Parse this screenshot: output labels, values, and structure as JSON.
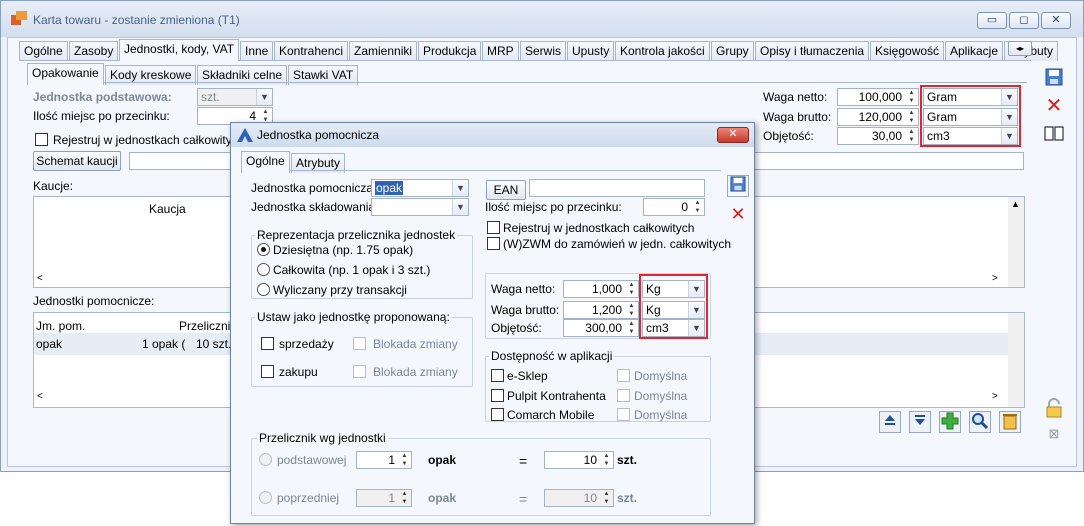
{
  "window": {
    "title": "Karta towaru - zostanie zmieniona (T1)",
    "minimize": "▭",
    "maximize": "◻",
    "close": "✕"
  },
  "main_tabs": [
    "Ogólne",
    "Zasoby",
    "Jednostki, kody, VAT",
    "Inne",
    "Kontrahenci",
    "Zamienniki",
    "Produkcja",
    "MRP",
    "Serwis",
    "Upusty",
    "Kontrola jakości",
    "Grupy",
    "Opisy i tłumaczenia",
    "Księgowość",
    "Aplikacje",
    "Atrybuty"
  ],
  "tab_scroll": [
    "◂",
    "▸"
  ],
  "sub_tabs": [
    "Opakowanie",
    "Kody kreskowe",
    "Składniki celne",
    "Stawki VAT"
  ],
  "unit_section": {
    "base_unit_label": "Jednostka podstawowa:",
    "base_unit_value": "szt.",
    "decimals_label": "Ilość miejsc po przecinku:",
    "decimals_value": "4",
    "register_label": "Rejestruj w jednostkach całkowitych",
    "deposit_button": "Schemat kaucji",
    "deposits_label": "Kaucje:",
    "deposit_col": "Kaucja",
    "aux_units_label": "Jednostki pomocnicze:",
    "aux_cols": [
      "Jm. pom.",
      "Przelicznik"
    ],
    "aux_row": {
      "unit": "opak",
      "conv1": "1 opak (",
      "conv2": "10 szt.)"
    }
  },
  "weights": {
    "net_label": "Waga netto:",
    "net_value": "100,000",
    "net_unit": "Gram",
    "gross_label": "Waga brutto:",
    "gross_value": "120,000",
    "gross_unit": "Gram",
    "volume_label": "Objętość:",
    "volume_value": "30,00",
    "volume_unit": "cm3"
  },
  "dialog": {
    "title": "Jednostka pomocnicza",
    "tabs": [
      "Ogólne",
      "Atrybuty"
    ],
    "aux_unit_label": "Jednostka pomocnicza:",
    "aux_unit_value": "opak",
    "storage_unit_label": "Jednostka składowania:",
    "storage_unit_value": "",
    "ean_button": "EAN",
    "ean_value": "",
    "decimals_label": "Ilość miejsc po przecinku:",
    "decimals_value": "0",
    "repr_title": "Reprezentacja przelicznika jednostek",
    "repr_options": [
      "Dziesiętna (np. 1.75 opak)",
      "Całkowita (np. 1 opak i 3 szt.)",
      "Wyliczany przy transakcji"
    ],
    "register_label": "Rejestruj w jednostkach całkowitych",
    "wzwm_label": "(W)ZWM do zamówień w jedn. całkowitych",
    "proposed_title": "Ustaw jako jednostkę proponowaną:",
    "sales_label": "sprzedaży",
    "purchase_label": "zakupu",
    "lock_label": "Blokada zmiany",
    "net_label": "Waga netto:",
    "net_value": "1,000",
    "net_unit": "Kg",
    "gross_label": "Waga brutto:",
    "gross_value": "1,200",
    "gross_unit": "Kg",
    "volume_label": "Objętość:",
    "volume_value": "300,00",
    "volume_unit": "cm3",
    "availability_title": "Dostępność w aplikacji",
    "apps": [
      "e-Sklep",
      "Pulpit Kontrahenta",
      "Comarch Mobile"
    ],
    "default_label": "Domyślna",
    "converter_title": "Przelicznik wg jednostki",
    "base_label": "podstawowej",
    "prev_label": "poprzedniej",
    "conv_row1": {
      "left": "1",
      "unit_left": "opak",
      "eq": "=",
      "right": "10",
      "unit_right": "szt."
    },
    "conv_row2": {
      "left": "1",
      "unit_left": "opak",
      "eq": "=",
      "right": "10",
      "unit_right": "szt."
    }
  },
  "colors": {
    "highlight": "#e0262e",
    "accent": "#2f63b5"
  }
}
